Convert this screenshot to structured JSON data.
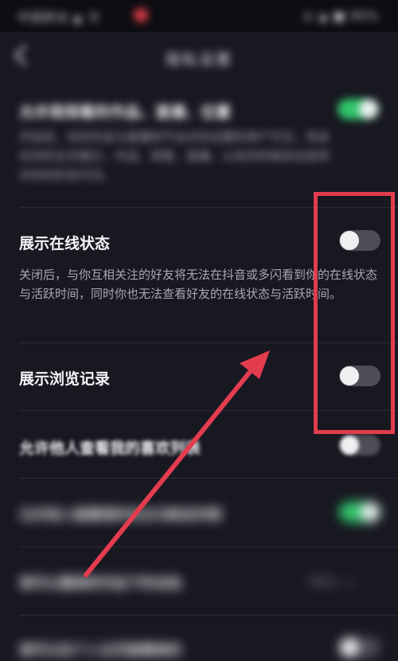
{
  "status_bar": {
    "left_text": "中国移动 ▲ 令",
    "right_text": "◎ ▲ ■ 96%"
  },
  "nav": {
    "title": "隐私设置"
  },
  "rows": {
    "top_blurred": {
      "title": "允许我观看的作品、直播、位置",
      "desc": "开启后，你的作品与直播将不会对你设置的用户可见，将会在你的主页展示，作品、观看、直播，以及你的相关信息将对你的好友可见。",
      "toggle_on": true
    },
    "online_status": {
      "title": "展示在线状态",
      "desc": "关闭后，与你互相关注的好友将无法在抖音或多闪看到你的在线状态与活跃时间，同时你也无法查看好友的在线状态与活跃时间。",
      "toggle_on": false
    },
    "browse_history": {
      "title": "展示浏览记录",
      "toggle_on": false
    },
    "likes_list": {
      "title": "允许他人查看我的喜欢列表",
      "toggle_on": false
    },
    "blurred_row_5": {
      "title": "允许他人查看我的关注与粉丝列表",
      "toggle_on": true
    },
    "blurred_row_6": {
      "title": "谁可以看我的作品下的合拍",
      "value": "所有人 >"
    },
    "blurred_row_7": {
      "title": "谁可以在个人主页查看我的",
      "toggle_on": false
    }
  },
  "colors": {
    "background": "#181821",
    "toggle_on": "#31c56b",
    "toggle_off": "#4d4d57",
    "annotation_red": "#e23c4e"
  }
}
